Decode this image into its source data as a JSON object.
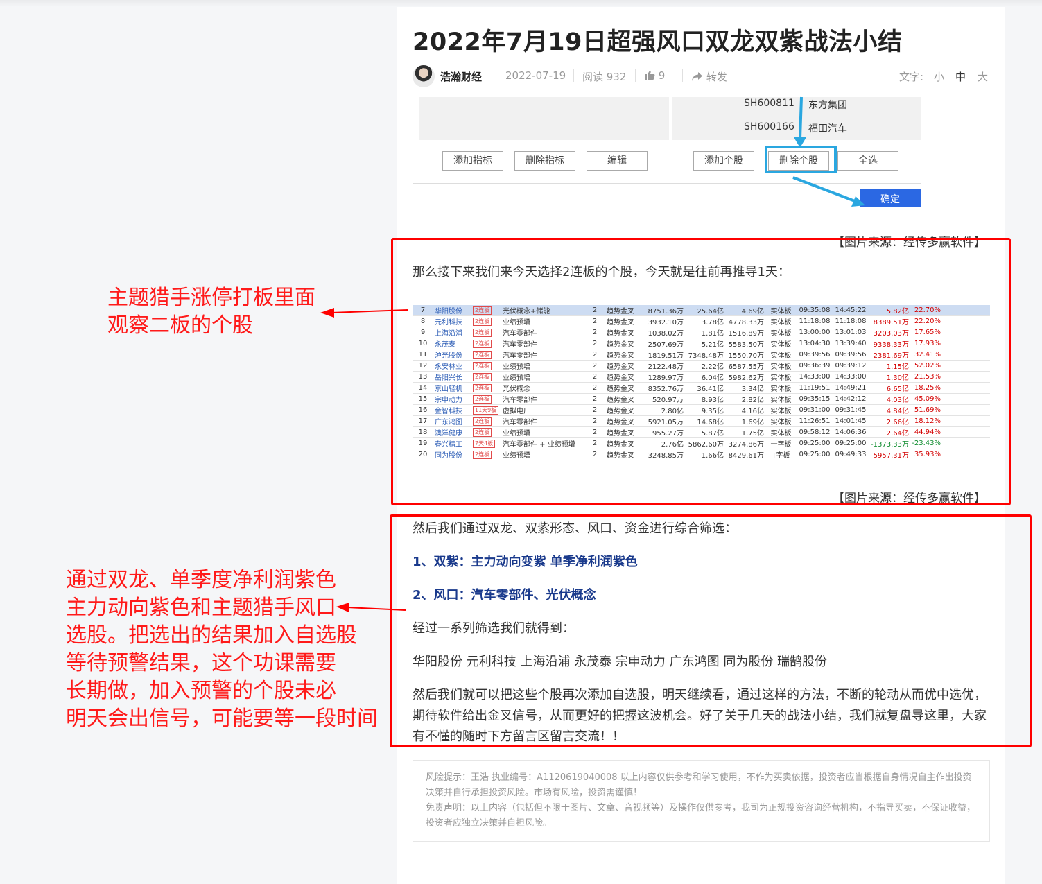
{
  "article": {
    "title": "2022年7月19日超强风口双龙双紫战法小结",
    "author": "浩瀚财经",
    "date": "2022-07-19",
    "reads": "阅读 932",
    "likes": "9",
    "share": "转发",
    "font_label": "文字:",
    "font_small": "小",
    "font_medium": "中",
    "font_large": "大"
  },
  "software_panel": {
    "rows": [
      {
        "code": "SH600811",
        "name": "东方集团"
      },
      {
        "code": "SH600166",
        "name": "福田汽车"
      }
    ],
    "buttons": [
      "添加指标",
      "删除指标",
      "编辑",
      "添加个股",
      "删除个股",
      "全选"
    ],
    "confirm": "确定"
  },
  "captions": {
    "first": "【图片来源：经传多赢软件】",
    "second": "【图片来源：经传多赢软件】"
  },
  "paragraphs": {
    "intro": "那么接下来我们来今天选择2连板的个股，今天就是往前再推导1天：",
    "screen": "然后我们通过双龙、双紫形态、风口、资金进行综合筛选：",
    "point1": "1、双紫：主力动向变紫 单季净利润紫色",
    "point2": "2、风口：汽车零部件、光伏概念",
    "result_intro": "经过一系列筛选我们就得到：",
    "result_list": "华阳股份 元利科技 上海沿浦 永茂泰 宗申动力 广东鸿图 同为股份 瑞鹄股份",
    "closing": "然后我们就可以把这些个股再次添加自选股，明天继续看，通过这样的方法，不断的轮动从而优中选优，期待软件给出金叉信号，从而更好的把握这波机会。好了关于几天的战法小结，我们就复盘导这里，大家有不懂的随时下方留言区留言交流！！"
  },
  "stock_table": {
    "rows": [
      [
        "7",
        "华阳股份",
        "2连板",
        "光伏概念+储能",
        "2",
        "趋势金叉",
        "8751.36万",
        "25.64亿",
        "4.69亿",
        "实体板",
        "09:35:08",
        "14:45:22",
        "5.82亿",
        "22.70%"
      ],
      [
        "8",
        "元利科技",
        "2连板",
        "业绩预增",
        "2",
        "趋势金叉",
        "3932.10万",
        "3.78亿",
        "4778.33万",
        "实体板",
        "11:18:08",
        "11:18:08",
        "8389.51万",
        "22.20%"
      ],
      [
        "9",
        "上海沿浦",
        "2连板",
        "汽车零部件",
        "2",
        "趋势金叉",
        "1038.02万",
        "1.81亿",
        "1516.89万",
        "实体板",
        "13:00:00",
        "13:01:03",
        "3203.03万",
        "17.65%"
      ],
      [
        "10",
        "永茂泰",
        "2连板",
        "汽车零部件",
        "2",
        "趋势金叉",
        "2507.69万",
        "5.21亿",
        "5583.50万",
        "实体板",
        "13:04:30",
        "13:39:40",
        "9338.33万",
        "17.93%"
      ],
      [
        "11",
        "沪光股份",
        "2连板",
        "汽车零部件",
        "2",
        "趋势金叉",
        "1819.51万",
        "7348.48万",
        "1550.70万",
        "实体板",
        "09:39:56",
        "09:39:56",
        "2381.69万",
        "32.41%"
      ],
      [
        "12",
        "永安林业",
        "2连板",
        "业绩预增",
        "2",
        "趋势金叉",
        "2122.48万",
        "2.22亿",
        "6587.55万",
        "实体板",
        "09:36:39",
        "09:39:12",
        "1.15亿",
        "52.02%"
      ],
      [
        "13",
        "岳阳兴长",
        "2连板",
        "业绩预增",
        "2",
        "趋势金叉",
        "1289.97万",
        "6.04亿",
        "5982.62万",
        "实体板",
        "14:33:00",
        "14:33:00",
        "1.30亿",
        "21.53%"
      ],
      [
        "14",
        "京山轻机",
        "2连板",
        "光伏概念",
        "2",
        "趋势金叉",
        "8352.76万",
        "36.41亿",
        "3.34亿",
        "实体板",
        "11:19:51",
        "14:49:21",
        "6.65亿",
        "18.25%"
      ],
      [
        "15",
        "宗申动力",
        "2连板",
        "汽车零部件",
        "2",
        "趋势金叉",
        "520.97万",
        "8.93亿",
        "2.82亿",
        "实体板",
        "09:35:15",
        "14:42:12",
        "4.03亿",
        "45.09%"
      ],
      [
        "16",
        "金智科技",
        "11天9板",
        "虚拟电厂",
        "2",
        "趋势金叉",
        "2.80亿",
        "9.35亿",
        "4.16亿",
        "实体板",
        "09:31:00",
        "09:31:45",
        "4.84亿",
        "51.69%"
      ],
      [
        "17",
        "广东鸿图",
        "2连板",
        "汽车零部件",
        "2",
        "趋势金叉",
        "5921.05万",
        "14.68亿",
        "1.69亿",
        "实体板",
        "11:26:51",
        "14:01:45",
        "2.66亿",
        "18.12%"
      ],
      [
        "18",
        "澳洋健康",
        "2连板",
        "业绩预增",
        "2",
        "趋势金叉",
        "955.27万",
        "5.87亿",
        "1.75亿",
        "实体板",
        "09:58:12",
        "14:06:36",
        "2.64亿",
        "44.94%"
      ],
      [
        "19",
        "春兴精工",
        "7天4板",
        "汽车零部件 + 业绩预增",
        "2",
        "趋势金叉",
        "2.76亿",
        "5862.60万",
        "3274.86万",
        "一字板",
        "09:25:00",
        "09:25:00",
        "-1373.33万",
        "-23.43%"
      ],
      [
        "20",
        "同为股份",
        "2连板",
        "业绩预增",
        "2",
        "趋势金叉",
        "3248.85万",
        "1.66亿",
        "8429.61万",
        "T字板",
        "09:25:00",
        "09:49:33",
        "5957.31万",
        "35.93%"
      ]
    ]
  },
  "risk": {
    "line1": "风险提示：王浩 执业编号：A1120619040008 以上内容仅供参考和学习使用，不作为买卖依据，投资者应当根据自身情况自主作出投资决策并自行承担投资风险。市场有风险，投资需谨慎！",
    "line2": "免责声明：以上内容（包括但不限于图片、文章、音视频等）及操作仅供参考，我司为正规投资咨询经营机构，不指导买卖，不保证收益，投资者应独立决策并自担风险。"
  },
  "annotations": {
    "note1": [
      "主题猎手涨停打板里面",
      "观察二板的个股"
    ],
    "note2": [
      "通过双龙、单季度净利润紫色",
      "主力动向紫色和主题猎手风口",
      "选股。把选出的结果加入自选股",
      "等待预警结果，这个功课需要",
      "长期做，加入预警的个股未必",
      "明天会出信号，可能要等一段时间"
    ]
  },
  "colors": {
    "annotation_red": "#ff0000",
    "highlight_blue": "#2aa7e0",
    "confirm_blue": "#2b68e3",
    "point_blue": "#1a3a8c"
  }
}
